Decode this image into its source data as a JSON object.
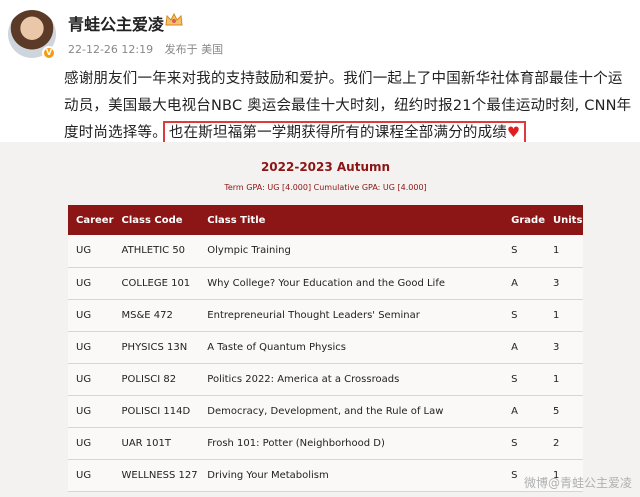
{
  "post": {
    "username": "青蛙公主爱凌",
    "verified_badge": "V",
    "date": "22-12-26 12:19",
    "source": "发布于 美国",
    "text_main": "感谢朋友们一年来对我的支持鼓励和爱护。我们一起上了中国新华社体育部最佳十个运动员，美国最大电视台NBC 奥运会最佳十大时刻，纽约时报21个最佳运动时刻, CNN年度时尚选择等。",
    "text_highlight": "也在斯坦福第一学期获得所有的课程全部满分的成绩",
    "heart": "♥"
  },
  "transcript": {
    "term": "2022-2023 Autumn",
    "gpa_line": "Term GPA: UG [4.000]  Cumulative GPA: UG [4.000]",
    "columns": [
      "Career",
      "Class Code",
      "Class Title",
      "Grade",
      "Units"
    ],
    "rows": [
      [
        "UG",
        "ATHLETIC 50",
        "Olympic Training",
        "S",
        "1"
      ],
      [
        "UG",
        "COLLEGE 101",
        "Why College? Your Education and the Good Life",
        "A",
        "3"
      ],
      [
        "UG",
        "MS&E 472",
        "Entrepreneurial Thought Leaders' Seminar",
        "S",
        "1"
      ],
      [
        "UG",
        "PHYSICS 13N",
        "A Taste of Quantum Physics",
        "A",
        "3"
      ],
      [
        "UG",
        "POLISCI 82",
        "Politics 2022: America at a Crossroads",
        "S",
        "1"
      ],
      [
        "UG",
        "POLISCI 114D",
        "Democracy, Development, and the Rule of Law",
        "A",
        "5"
      ],
      [
        "UG",
        "UAR 101T",
        "Frosh 101: Potter (Neighborhood D)",
        "S",
        "2"
      ],
      [
        "UG",
        "WELLNESS 127",
        "Driving Your Metabolism",
        "S",
        "1"
      ]
    ]
  },
  "watermark": "微博@青蛙公主爱凌",
  "colors": {
    "accent": "#8c1515",
    "highlight_border": "#e03b3b"
  }
}
